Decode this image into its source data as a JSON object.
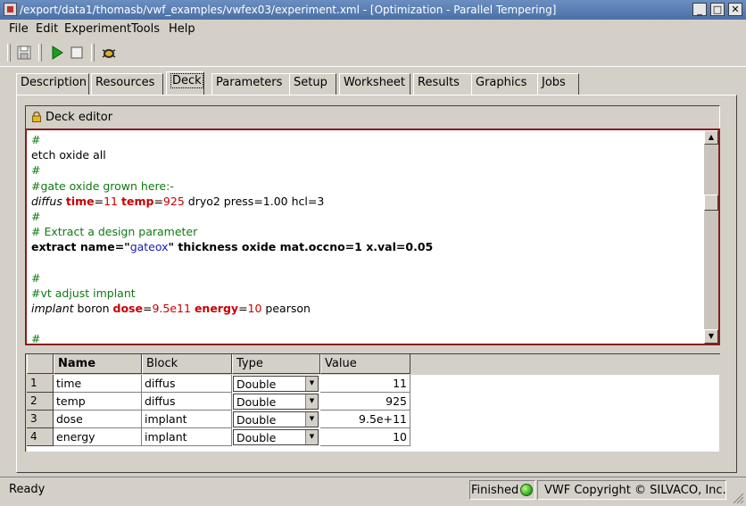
{
  "window": {
    "title": "/export/data1/thomasb/vwf_examples/vwfex03/experiment.xml - [Optimization - Parallel Tempering]",
    "minimize_label": "_",
    "maximize_label": "□",
    "close_label": "✕"
  },
  "menu": {
    "items": [
      "File",
      "Edit",
      "Experiment",
      "Tools",
      "Help"
    ]
  },
  "toolbar": {
    "icons": [
      "save-icon",
      "run-icon",
      "stop-icon",
      "debug-icon"
    ]
  },
  "tabs": [
    {
      "label": "Description",
      "active": false
    },
    {
      "label": "Resources",
      "active": false
    },
    {
      "label": "Deck",
      "active": true
    },
    {
      "label": "Parameters",
      "active": false
    },
    {
      "label": "Setup",
      "active": false
    },
    {
      "label": "Worksheet",
      "active": false
    },
    {
      "label": "Results",
      "active": false
    },
    {
      "label": "Graphics",
      "active": false
    },
    {
      "label": "Jobs",
      "active": false
    }
  ],
  "deck_editor": {
    "label": "Deck editor",
    "lines": [
      [
        {
          "t": "#",
          "c": "cm"
        }
      ],
      [
        {
          "t": "etch oxide all",
          "c": ""
        }
      ],
      [
        {
          "t": "#",
          "c": "cm"
        }
      ],
      [
        {
          "t": "#gate oxide grown here:-",
          "c": "cm"
        }
      ],
      [
        {
          "t": "diffus",
          "c": "it"
        },
        {
          "t": " ",
          "c": ""
        },
        {
          "t": "time",
          "c": "kw"
        },
        {
          "t": "=",
          "c": ""
        },
        {
          "t": "11",
          "c": "num"
        },
        {
          "t": " ",
          "c": ""
        },
        {
          "t": "temp",
          "c": "kw"
        },
        {
          "t": "=",
          "c": ""
        },
        {
          "t": "925",
          "c": "num"
        },
        {
          "t": " dryo2 press=1.00 hcl=3",
          "c": ""
        }
      ],
      [
        {
          "t": "#",
          "c": "cm"
        }
      ],
      [
        {
          "t": "# Extract a design parameter",
          "c": "cm"
        }
      ],
      [
        {
          "t": "extract name=\"",
          "c": "b"
        },
        {
          "t": "gateox",
          "c": "str"
        },
        {
          "t": "\" thickness oxide mat.occno=1 x.val=0.05",
          "c": "b"
        }
      ],
      [
        {
          "t": "",
          "c": ""
        }
      ],
      [
        {
          "t": "#",
          "c": "cm"
        }
      ],
      [
        {
          "t": "#vt adjust implant",
          "c": "cm"
        }
      ],
      [
        {
          "t": "implant",
          "c": "it"
        },
        {
          "t": " boron ",
          "c": ""
        },
        {
          "t": "dose",
          "c": "kw"
        },
        {
          "t": "=",
          "c": ""
        },
        {
          "t": "9.5e11",
          "c": "num"
        },
        {
          "t": " ",
          "c": ""
        },
        {
          "t": "energy",
          "c": "kw"
        },
        {
          "t": "=",
          "c": ""
        },
        {
          "t": "10",
          "c": "num"
        },
        {
          "t": " pearson",
          "c": ""
        }
      ],
      [
        {
          "t": "",
          "c": ""
        }
      ],
      [
        {
          "t": "#",
          "c": "cm"
        }
      ]
    ]
  },
  "param_table": {
    "headers": [
      "Name",
      "Block",
      "Type",
      "Value"
    ],
    "rows": [
      {
        "index": "1",
        "name": "time",
        "block": "diffus",
        "type": "Double",
        "value": "11"
      },
      {
        "index": "2",
        "name": "temp",
        "block": "diffus",
        "type": "Double",
        "value": "925"
      },
      {
        "index": "3",
        "name": "dose",
        "block": "implant",
        "type": "Double",
        "value": "9.5e+11"
      },
      {
        "index": "4",
        "name": "energy",
        "block": "implant",
        "type": "Double",
        "value": "10"
      }
    ]
  },
  "status": {
    "text": "Ready",
    "job_state": "Finished",
    "job_state_color": "#2aa31a",
    "copyright": "VWF Copyright ©  SILVACO, Inc."
  }
}
